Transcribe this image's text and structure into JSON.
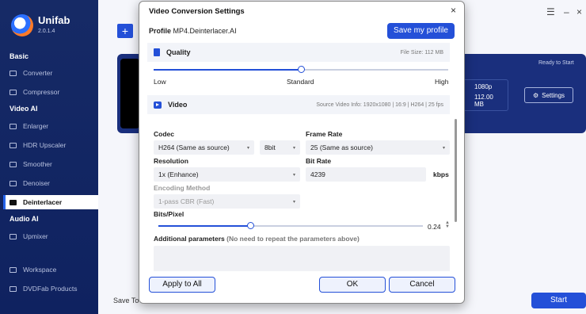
{
  "app": {
    "brand": "Unifab",
    "version": "2.0.1.4"
  },
  "sidebar": {
    "sections": [
      "Basic",
      "Video AI",
      "Audio AI"
    ],
    "items": [
      {
        "label": "Converter"
      },
      {
        "label": "Compressor"
      },
      {
        "label": "Enlarger"
      },
      {
        "label": "HDR Upscaler"
      },
      {
        "label": "Smoother"
      },
      {
        "label": "Denoiser"
      },
      {
        "label": "Deinterlacer"
      },
      {
        "label": "Upmixer"
      },
      {
        "label": "Workspace"
      },
      {
        "label": "DVDFab Products"
      }
    ]
  },
  "main": {
    "add_symbol": "+",
    "ready": "Ready to Start",
    "resolution": "1080p",
    "size": "112.00 MB",
    "settings_label": "Settings",
    "save_to": "Save To",
    "start_label": "Start"
  },
  "dialog": {
    "title": "Video Conversion Settings",
    "close": "×",
    "profile_label": "Profile",
    "profile_value": "MP4.Deinterlacer.AI",
    "save_profile": "Save my profile",
    "quality": {
      "header": "Quality",
      "file_size": "File Size:  112 MB",
      "low": "Low",
      "standard": "Standard",
      "high": "High",
      "level": 0.5
    },
    "video": {
      "header": "Video",
      "source_info": "Source Video Info: 1920x1080 | 16:9 | H264 | 25 fps",
      "codec_label": "Codec",
      "codec_value": "H264 (Same as source)",
      "bitdepth_value": "8bit",
      "framerate_label": "Frame Rate",
      "framerate_value": "25 (Same as source)",
      "resolution_label": "Resolution",
      "resolution_value": "1x (Enhance)",
      "bitrate_label": "Bit Rate",
      "bitrate_value": "4239",
      "bitrate_unit": "kbps",
      "encoding_label": "Encoding Method",
      "encoding_value": "1-pass CBR (Fast)",
      "bpp_label": "Bits/Pixel",
      "bpp_value": "0.24",
      "additional_label": "Additional parameters",
      "additional_hint": "(No need to repeat the parameters above)"
    },
    "apply_all": "Apply to All",
    "ok": "OK",
    "cancel": "Cancel"
  },
  "colors": {
    "accent": "#2450d8",
    "sidebar": "#162a66"
  }
}
